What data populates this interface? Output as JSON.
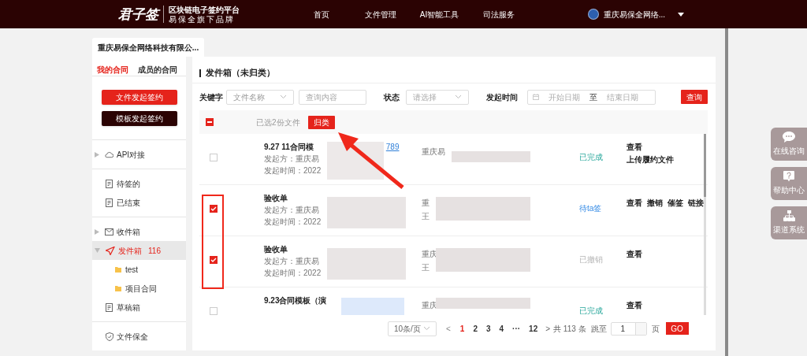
{
  "header": {
    "logo": "君子签",
    "tagline": "区块链电子签约平台",
    "subtagline": "易保全旗下品牌",
    "nav": [
      {
        "label": "首页"
      },
      {
        "label": "文件管理"
      },
      {
        "label": "AI智能工具"
      },
      {
        "label": "司法服务"
      }
    ],
    "user": "重庆易保全网络..."
  },
  "company_tab": "重庆易保全网络科技有限公...",
  "sidebar": {
    "tabs": [
      {
        "label": "我的合同",
        "selected": true
      },
      {
        "label": "成员的合同",
        "selected": false
      }
    ],
    "buttons": [
      {
        "label": "文件发起签约",
        "kind": "primary"
      },
      {
        "label": "模板发起签约",
        "kind": "dark"
      }
    ],
    "groups": [
      [
        {
          "label": "API对接",
          "kind": "cloud",
          "expanded": false,
          "selected": false
        }
      ],
      [
        {
          "label": "待签的",
          "kind": "doc",
          "selected": false
        },
        {
          "label": "已结束",
          "kind": "doc",
          "selected": false
        }
      ],
      [
        {
          "label": "收件箱",
          "kind": "mail",
          "expanded": false,
          "selected": false
        },
        {
          "label": "发件箱",
          "count": "116",
          "kind": "send",
          "expanded": true,
          "selected": true,
          "children": [
            {
              "label": "test",
              "selected": false
            },
            {
              "label": "项目合同",
              "selected": false
            }
          ]
        },
        {
          "label": "草稿箱",
          "kind": "doc",
          "selected": false
        }
      ],
      [
        {
          "label": "文件保全",
          "kind": "shield",
          "selected": false
        }
      ]
    ]
  },
  "panel": {
    "title": "发件箱（未归类）",
    "filters": {
      "keyword_label": "关键字",
      "keyword_select": "文件名称",
      "keyword_placeholder": "查询内容",
      "status_label": "状态",
      "status_placeholder": "请选择",
      "time_label": "发起时间",
      "start_placeholder": "开始日期",
      "range_sep": "至",
      "end_placeholder": "结束日期",
      "search_button": "查询"
    },
    "selection": {
      "partially_checked": true,
      "summary": "已选2份文件",
      "classify_button": "归类"
    },
    "rows": [
      {
        "checked": false,
        "title": "9.27 11合同模",
        "link": "789",
        "initiator": "发起方：重庆易",
        "time": "发起时间：2022",
        "parties": [
          "重庆易"
        ],
        "status": "已完成",
        "kind": "done",
        "actions": [
          "查看",
          "上传履约文件"
        ],
        "stacked": true
      },
      {
        "checked": true,
        "title": "验收单",
        "initiator": "发起方：重庆易",
        "time": "发起时间：2022",
        "parties": [
          "重",
          "王"
        ],
        "status": "待ta签",
        "kind": "pending",
        "actions": [
          "查看",
          "撤销",
          "催签",
          "链接"
        ],
        "stacked": false
      },
      {
        "checked": true,
        "title": "验收单",
        "initiator": "发起方：重庆易",
        "time": "发起时间：2022",
        "parties": [
          "重庆",
          "王"
        ],
        "status": "已撤销",
        "kind": "revoked",
        "actions": [
          "查看"
        ]
      },
      {
        "checked": false,
        "title": "9.23合同模板（演",
        "parties": [
          "重庆"
        ],
        "status": "已完成",
        "kind": "done",
        "actions": [
          "查看"
        ]
      }
    ],
    "pagination": {
      "page_size": "10条/页",
      "prev": "<",
      "pages": [
        {
          "label": "1",
          "selected": true
        },
        {
          "label": "2",
          "selected": false
        },
        {
          "label": "3",
          "selected": false
        },
        {
          "label": "4",
          "selected": false
        },
        {
          "label": "···",
          "selected": false
        },
        {
          "label": "12",
          "selected": false
        }
      ],
      "next": ">",
      "total": "共 113 条",
      "jump_label": "跳至",
      "jump_value": "1",
      "page_unit": "页",
      "go": "GO"
    }
  },
  "float_buttons": [
    {
      "label": "在线咨询",
      "kind": "chat"
    },
    {
      "label": "帮助中心",
      "kind": "help"
    },
    {
      "label": "渠道系统",
      "kind": "tree"
    }
  ]
}
